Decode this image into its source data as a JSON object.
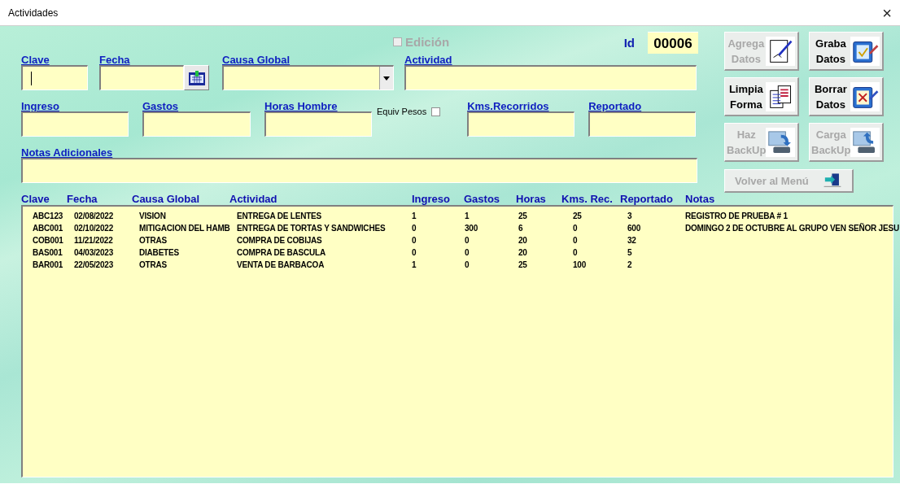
{
  "window": {
    "title": "Actividades",
    "close": "×"
  },
  "edicion": {
    "label": "Edición",
    "checked": false,
    "disabled": true
  },
  "id": {
    "label": "Id",
    "value": "00006"
  },
  "field_rows": [
    [
      {
        "kind": "text",
        "label": "Clave",
        "focused": true
      },
      {
        "kind": "date",
        "label": "Fecha",
        "focused": false
      },
      {
        "kind": "dropdown",
        "label": "Causa Global",
        "focused": false
      },
      {
        "kind": "text",
        "label": "Actividad",
        "focused": false
      }
    ],
    [
      {
        "kind": "text",
        "label": "Ingreso",
        "focused": false
      },
      {
        "kind": "text",
        "label": "Gastos",
        "focused": false
      },
      {
        "kind": "text",
        "label": "Horas Hombre",
        "focused": false
      },
      {
        "kind": "check",
        "label": "Equiv Pesos",
        "checked": false
      },
      {
        "kind": "text",
        "label": "Kms.Recorridos",
        "focused": false
      },
      {
        "kind": "text",
        "label": "Reportado",
        "focused": false
      }
    ],
    [
      {
        "kind": "text",
        "label": "Notas Adicionales",
        "focused": false
      }
    ]
  ],
  "buttons": [
    {
      "label": "Agrega Datos",
      "disabled": true
    },
    {
      "label": "Graba Datos",
      "disabled": false
    },
    {
      "label": "Limpia Forma",
      "disabled": false
    },
    {
      "label": "Borrar Datos",
      "disabled": false
    },
    {
      "label": "Haz BackUp",
      "disabled": true
    },
    {
      "label": "Carga BackUp",
      "disabled": true
    },
    {
      "label": "Volver al Menú",
      "disabled": true
    }
  ],
  "table": {
    "columns": [
      "Clave",
      "Fecha",
      "Causa Global",
      "Actividad",
      "Ingreso",
      "Gastos",
      "Horas",
      "Kms. Rec.",
      "Reportado",
      "Notas"
    ],
    "rows": [
      [
        "ABC123",
        "02/08/2022",
        "VISION",
        "ENTREGA DE LENTES",
        "1",
        "1",
        "25",
        "25",
        "3",
        "REGISTRO DE PRUEBA # 1"
      ],
      [
        "ABC001",
        "02/10/2022",
        "MITIGACION DEL HAMB",
        "ENTREGA DE TORTAS Y SANDWICHES",
        "0",
        "300",
        "6",
        "0",
        "600",
        "DOMINGO 2 DE OCTUBRE AL GRUPO VEN SEÑOR JESU"
      ],
      [
        "COB001",
        "11/21/2022",
        "OTRAS",
        "COMPRA DE COBIJAS",
        "0",
        "0",
        "20",
        "0",
        "32",
        ""
      ],
      [
        "BAS001",
        "04/03/2023",
        "DIABETES",
        "COMPRA DE BASCULA",
        "0",
        "0",
        "20",
        "0",
        "5",
        ""
      ],
      [
        "BAR001",
        "22/05/2023",
        "OTRAS",
        "VENTA DE BARBACOA",
        "1",
        "0",
        "25",
        "100",
        "2",
        ""
      ]
    ]
  }
}
